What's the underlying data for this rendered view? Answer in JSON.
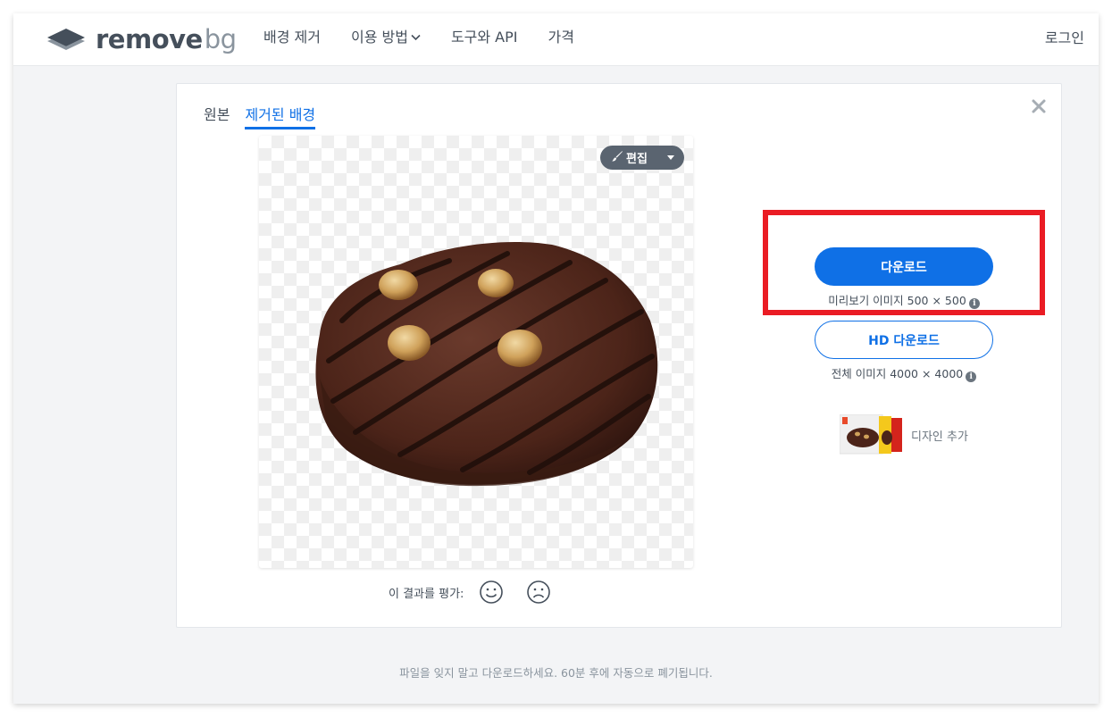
{
  "header": {
    "logo_main": "remove",
    "logo_accent": "bg",
    "nav": [
      {
        "label": "배경 제거"
      },
      {
        "label": "이용 방법"
      },
      {
        "label": "도구와 API"
      },
      {
        "label": "가격"
      }
    ],
    "login_label": "로그인"
  },
  "card": {
    "tabs": [
      {
        "label": "원본",
        "active": false
      },
      {
        "label": "제거된 배경",
        "active": true
      }
    ],
    "edit_label": "편집",
    "rate_label": "이 결과를 평가:",
    "download_label": "다운로드",
    "download_sub": "미리보기 이미지 500 × 500",
    "hd_download_label": "HD 다운로드",
    "hd_download_sub": "전체 이미지 4000 × 4000",
    "add_design_label": "디자인 추가"
  },
  "footer_note": "파일을 잊지 말고 다운로드하세요. 60분 후에 자동으로 폐기됩니다.",
  "colors": {
    "accent": "#0f70e6",
    "highlight": "#ea1c24",
    "text": "#454f5b"
  },
  "icons": [
    "logo-layers-icon",
    "chevron-down-icon",
    "close-icon",
    "brush-icon",
    "caret-down-icon",
    "info-icon",
    "smiley-icon",
    "frown-icon"
  ]
}
